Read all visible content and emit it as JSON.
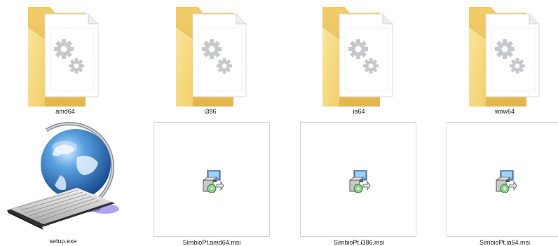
{
  "files": [
    {
      "name": "amd64",
      "type": "folder",
      "icon": "settings-folder-icon"
    },
    {
      "name": "i386",
      "type": "folder",
      "icon": "settings-folder-icon"
    },
    {
      "name": "ia64",
      "type": "folder",
      "icon": "settings-folder-icon"
    },
    {
      "name": "wow64",
      "type": "folder",
      "icon": "settings-folder-icon"
    },
    {
      "name": "setup.exe",
      "type": "executable",
      "icon": "globe-keyboard-icon"
    },
    {
      "name": "SimbioPt.amd64.msi",
      "type": "installer",
      "icon": "msi-installer-icon"
    },
    {
      "name": "SimbioPt.i386.msi",
      "type": "installer",
      "icon": "msi-installer-icon"
    },
    {
      "name": "SimbioPt.ia64.msi",
      "type": "installer",
      "icon": "msi-installer-icon"
    }
  ],
  "colors": {
    "folder_front": "#f5d57a",
    "folder_back": "#e9c25a",
    "page": "#ffffff",
    "gear": "#c9cccf",
    "tile_border": "#d3d3d3"
  }
}
